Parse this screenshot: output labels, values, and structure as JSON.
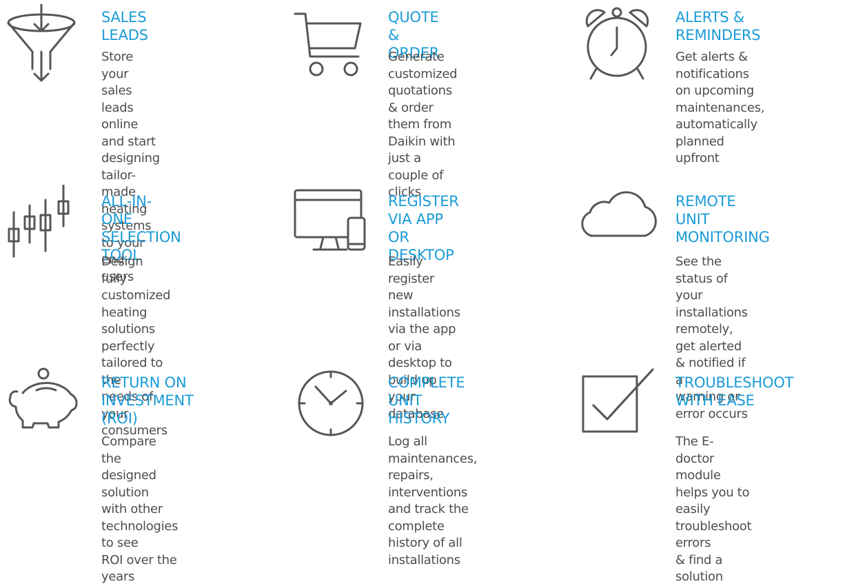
{
  "features": [
    {
      "title": "SALES LEADS",
      "desc": "Store your sales leads\nonline and start\ndesigning tailor-made\nheating systems to your\nend users",
      "icon": "funnel-icon"
    },
    {
      "title": "QUOTE & ORDER",
      "desc": "Generate customized\nquotations & order\nthem from Daikin with\njust a couple of clicks",
      "icon": "shopping-cart-icon"
    },
    {
      "title": "ALERTS & REMINDERS",
      "desc": "Get alerts & notifications\non upcoming\nmaintenances,\nautomatically\nplanned upfront",
      "icon": "alarm-clock-icon"
    },
    {
      "title": "ALL-IN-ONE\nSELECTION TOOL",
      "desc": "Design fully customized\nheating solutions\nperfectly tailored to the\nneeds of your consumers",
      "icon": "candlestick-chart-icon"
    },
    {
      "title": "REGISTER VIA APP\nOR DESKTOP",
      "desc": "Easily register new\ninstallations via the app\nor via desktop to build up\nyour database",
      "icon": "desktop-mobile-icon"
    },
    {
      "title": "REMOTE UNIT\nMONITORING",
      "desc": "See the status of your\ninstallations remotely,\nget alerted & notified if a\nwarning or error occurs",
      "icon": "cloud-icon"
    },
    {
      "title": "RETURN ON\nINVESTMENT (ROI)",
      "desc": "Compare the designed\nsolution with other\ntechnologies to see\nROI over the years",
      "icon": "piggy-bank-icon"
    },
    {
      "title": "COMPLETE UNIT\nHISTORY",
      "desc": "Log all maintenances,\nrepairs, interventions\nand track the complete\nhistory of all installations",
      "icon": "clock-icon"
    },
    {
      "title": "TROUBLESHOOT\nWITH EASE",
      "desc": "The E-doctor module\nhelps you to easily\ntroubleshoot errors\n& find a solution",
      "icon": "checkbox-icon"
    }
  ],
  "colors": {
    "accent": "#1a9bd7",
    "text": "#4d4d4d",
    "icon": "#565656"
  }
}
